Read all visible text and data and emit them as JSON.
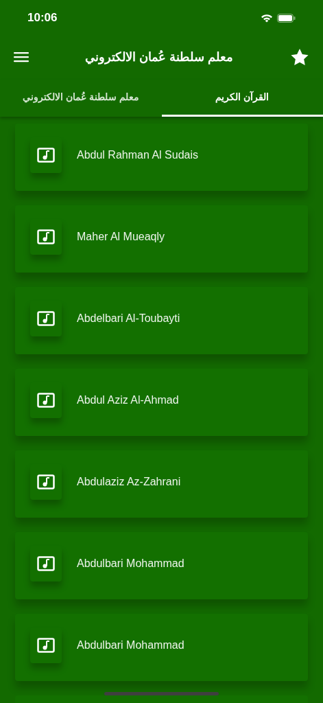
{
  "status_bar": {
    "time": "10:06"
  },
  "app_bar": {
    "title": "معلم سلطنة عُمان الالكتروني"
  },
  "tabs": [
    {
      "label": "القرآن الكريم",
      "selected": true
    },
    {
      "label": "معلم سلطنة عُمان الالكتروني",
      "selected": false
    }
  ],
  "reciters": [
    {
      "name": "Abdul Rahman Al Sudais"
    },
    {
      "name": "Maher Al Mueaqly"
    },
    {
      "name": "Abdelbari Al-Toubayti"
    },
    {
      "name": "Abdul Aziz Al-Ahmad"
    },
    {
      "name": "Abdulaziz Az-Zahrani"
    },
    {
      "name": "Abdulbari Mohammad"
    },
    {
      "name": "Abdulbari Mohammad"
    }
  ]
}
